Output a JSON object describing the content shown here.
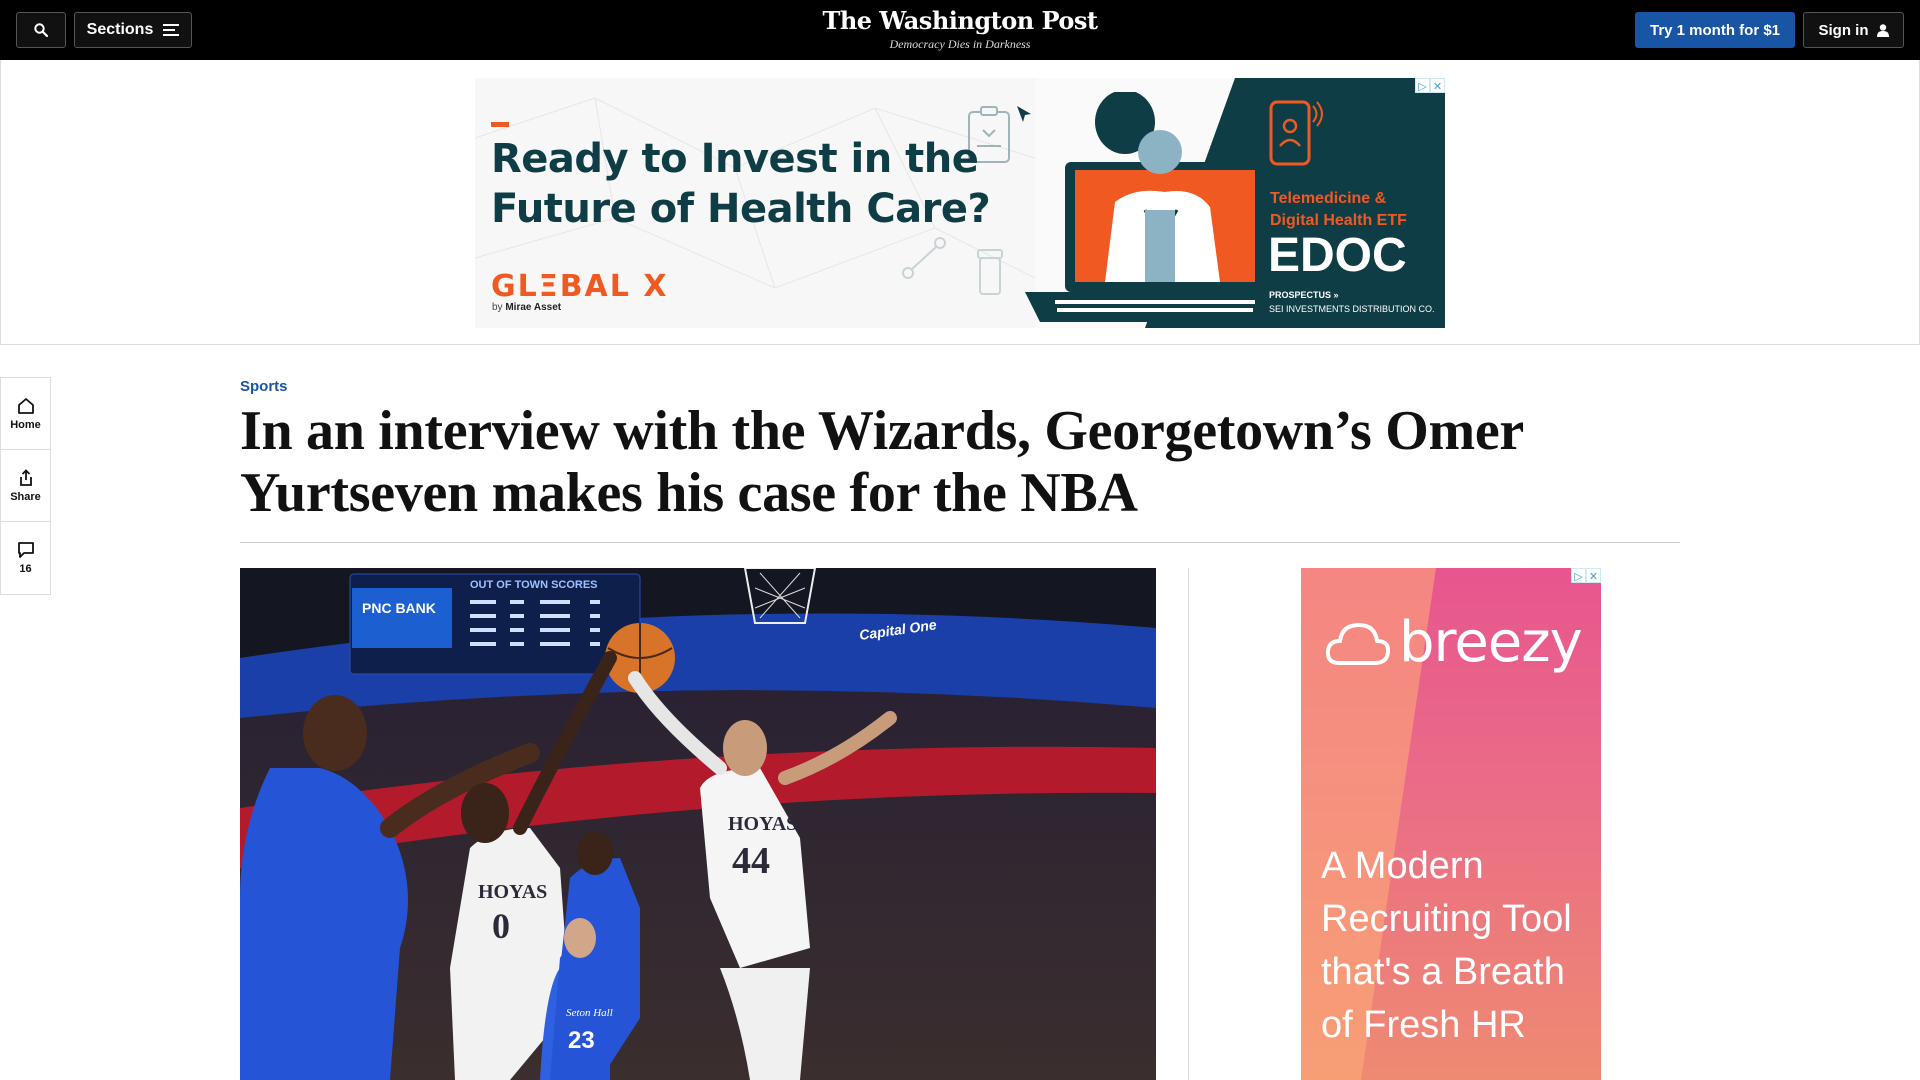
{
  "masthead": {
    "sections_label": "Sections",
    "logo_text": "The Washington Post",
    "tagline": "Democracy Dies in Darkness",
    "subscribe_label": "Try 1 month for $1",
    "signin_label": "Sign in"
  },
  "ad_top": {
    "headline": "Ready to Invest in the Future of Health Care?",
    "brand": "GLΞBAL X",
    "byline_prefix": "by",
    "byline_name": "Mirae Asset",
    "etf_label_1": "Telemedicine &",
    "etf_label_2": "Digital Health ETF",
    "ticker": "EDOC",
    "prospectus": "PROSPECTUS »",
    "distributor": "SEI INVESTMENTS DISTRIBUTION CO.",
    "colors": {
      "accent": "#f05a22",
      "dark": "#0f3d45"
    }
  },
  "rail": {
    "home_label": "Home",
    "share_label": "Share",
    "comments_count": "16"
  },
  "article": {
    "kicker": "Sports",
    "title": "In an interview with the Wizards, Georgetown’s Omer Yurtseven makes his case for the NBA"
  },
  "photo": {
    "scoreboard_title": "OUT OF TOWN SCORES",
    "sponsor_1": "PNC BANK",
    "sponsor_2": "Capital One",
    "jersey_left": "HOYAS",
    "jersey_left_number": "0",
    "jersey_right": "HOYAS",
    "jersey_right_number": "44",
    "opponent_number": "23",
    "opponent_name": "Seton Hall"
  },
  "ad_side": {
    "brand": "breezy",
    "copy": "A Modern Recruiting Tool that's a Breath of Fresh HR",
    "colors": {
      "top": "#e8558f",
      "bottom": "#ef8a72"
    }
  }
}
